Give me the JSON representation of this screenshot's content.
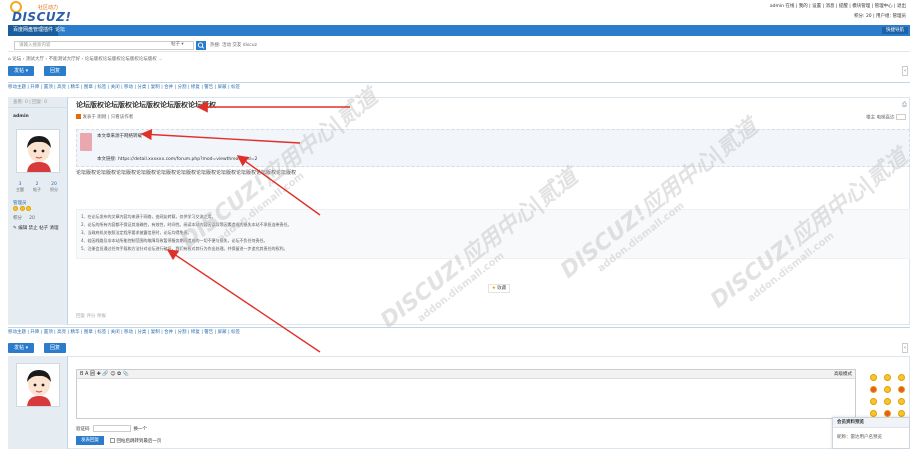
{
  "header": {
    "logo_brand": "DISCUZ!",
    "logo_tag": "社区动力",
    "user_links": "admin 在线 | 我的 | 设置 | 消息 | 提醒 | 模块管理 | 管理中心 | 退出",
    "user_links2": "积分: 20 | 用户组: 管理员"
  },
  "nav": {
    "items": [
      {
        "label": "百度网盘管理插件"
      },
      {
        "label": "论坛"
      }
    ],
    "right_button": "快捷导航"
  },
  "search": {
    "placeholder": "请输入搜索内容",
    "scope": "帖子",
    "hot_label": "热搜: 活动 交友 discuz"
  },
  "breadcrumb": "论坛 › 测试大厅 › 不能测试大厅好 › 论坛版权论坛版权论坛版权论坛版权 ...",
  "toolbar": {
    "post_button": "发帖",
    "reply_button": "回复"
  },
  "modbar_text": "移动主题 | 升降 | 置顶 | 高亮 | 精华 | 图章 | 标签 | 关闭 | 移动 | 分类 | 复制 | 合并 | 分割 | 修复 | 警告 | 屏蔽 | 标签",
  "author": {
    "head": "查看: 0 | 回复: 0",
    "name": "admin",
    "stats": [
      {
        "value": "3",
        "label": "主题"
      },
      {
        "value": "2",
        "label": "帖子"
      },
      {
        "value": "20",
        "label": "积分"
      }
    ],
    "group": "管理员",
    "credit_label": "积分",
    "credit_value": "20",
    "actions": "编辑 禁止 帖子 清理"
  },
  "post": {
    "title": "论坛版权论坛版权论坛版权论坛版权论坛版权",
    "meta": "发表于 刚刚 | 只看该作者",
    "right_meta": "楼主  电梯直达",
    "quote_line1": "本文章来源于网络转载",
    "quote_line2": "本文链接: https://detail.xxxxxx.com/forum.php?mod=viewthread&tid=2",
    "body": "论坛版权论坛版权论坛版权论坛版权论坛版权论坛版权论坛版权论坛版权论坛版权论坛版权论坛版权",
    "notes": [
      "1、在论坛发布的文章内容均来源于网络，由网友转载，仅供学习交流之用。",
      "2、论坛的所有内容都不保证其准确性，有效性，时间性。阅读本站内容因误导等因素造成的损失本站不承担连带责任。",
      "3、当政府机关依照法定程序要求披露信息时，论坛均得免责。",
      "4、若因线路及非本站所能控制范围的故障导致暂停服务期间造成的一切不便与损失，论坛不负任何责任。",
      "5、注册会员通过任何手段和方法针对论坛进行破坏，我们有权对其行为作出处理。并保留进一步追究其责任的权利。"
    ],
    "recommend_label": "收藏",
    "footer": "回复  评分  举报"
  },
  "reply": {
    "editor_toolbar": "B A 囲 ✚ 🔗 ☺ ✿ 📎",
    "advanced_label": "高级模式",
    "verify_label": "验证码",
    "verify_change": "换一个",
    "submit_label": "发表回复",
    "back_label": "回帖后跳转到最后一页"
  },
  "popup": {
    "title": "会员资料预览",
    "body": "昵称：雷达用户名预览"
  },
  "watermarks": [
    {
      "main": "DISCUZ!应用中心|贰道",
      "sub": "addon.dismall.com"
    }
  ],
  "colors": {
    "primary": "#2b7ccb",
    "author_bg": "#e5edf2",
    "arrow": "#e0302a"
  }
}
